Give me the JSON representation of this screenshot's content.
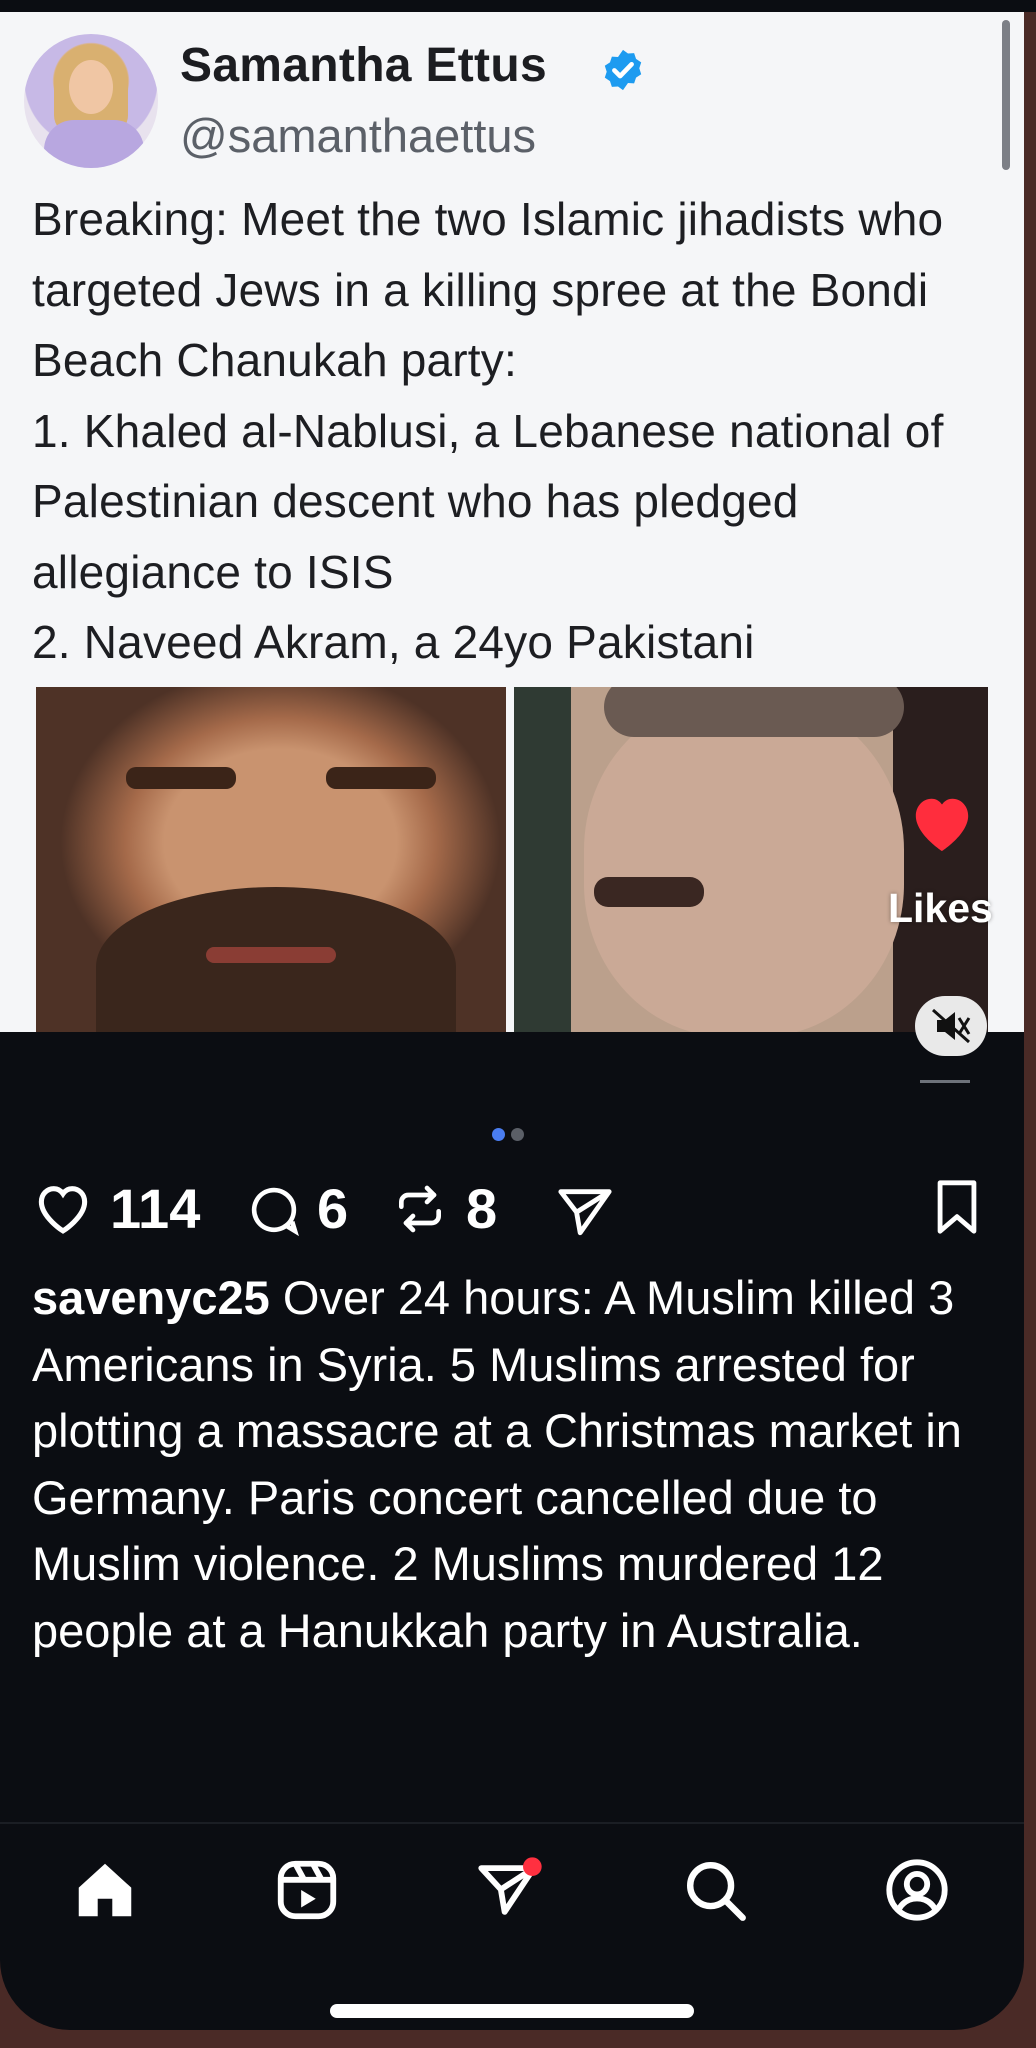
{
  "post": {
    "author_name": "Samantha Ettus",
    "handle": "@samanthaettus",
    "text_lines": [
      "Breaking: Meet the two Islamic jihadists who targeted Jews in a killing spree at the Bondi Beach Chanukah party:",
      "1. Khaled al-Nablusi, a Lebanese national of Palestinian descent who has pledged allegiance to ISIS",
      "2. Naveed Akram, a 24yo Pakistani"
    ]
  },
  "overlay": {
    "likes_label": "Likes"
  },
  "carousel": {
    "pages": 2,
    "active_index": 0
  },
  "actions": {
    "likes": "114",
    "comments": "6",
    "reposts": "8"
  },
  "caption": {
    "username": "savenyc25",
    "text": "Over 24 hours: A Muslim killed 3 Americans in Syria. 5 Muslims arrested for plotting a massacre at a Christmas market in Germany. Paris concert cancelled due to Muslim violence. 2 Muslims murdered 12 people at a Hanukkah party in Australia."
  },
  "bottom_nav": {
    "items": [
      "home-icon",
      "reels-icon",
      "messages-icon",
      "search-icon",
      "profile-icon"
    ],
    "messages_has_badge": true
  },
  "colors": {
    "accent_blue": "#4a7df0",
    "heart_red": "#ff2d3d",
    "notification_red": "#ff3040",
    "verified_blue": "#1d9bf0",
    "dark_background": "#0b0d12"
  }
}
